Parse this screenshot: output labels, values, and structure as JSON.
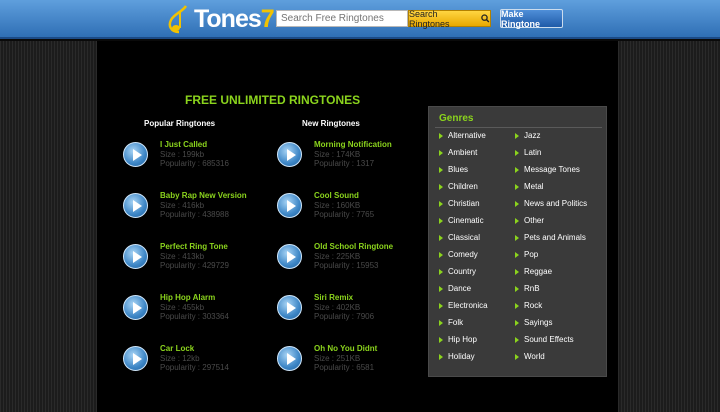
{
  "header": {
    "logo_text": "Tones",
    "logo_seven": "7",
    "search_placeholder": "Search Free Ringtones",
    "search_button": "Search Ringtones",
    "make_button": "Make Ringtone"
  },
  "main": {
    "title": "FREE UNLIMITED RINGTONES",
    "popular_heading": "Popular Ringtones",
    "new_heading": "New Ringtones",
    "popular": [
      {
        "name": "I Just Called",
        "size": "Size : 199kb",
        "popularity": "Popularity : 685316"
      },
      {
        "name": "Baby Rap New Version",
        "size": "Size : 416kb",
        "popularity": "Popularity : 438988"
      },
      {
        "name": "Perfect Ring Tone",
        "size": "Size : 413kb",
        "popularity": "Popularity : 429729"
      },
      {
        "name": "Hip Hop Alarm",
        "size": "Size : 455kb",
        "popularity": "Popularity : 303364"
      },
      {
        "name": "Car Lock",
        "size": "Size : 12kb",
        "popularity": "Popularity : 297514"
      }
    ],
    "new": [
      {
        "name": "Morning Notification",
        "size": "Size : 174KB",
        "popularity": "Popularity : 1317"
      },
      {
        "name": "Cool Sound",
        "size": "Size : 160KB",
        "popularity": "Popularity : 7765"
      },
      {
        "name": "Old School Ringtone",
        "size": "Size : 225KB",
        "popularity": "Popularity : 15953"
      },
      {
        "name": "Siri Remix",
        "size": "Size : 402KB",
        "popularity": "Popularity : 7906"
      },
      {
        "name": "Oh No You Didnt",
        "size": "Size : 251KB",
        "popularity": "Popularity : 6581"
      }
    ]
  },
  "genres": {
    "title": "Genres",
    "left": [
      "Alternative",
      "Ambient",
      "Blues",
      "Children",
      "Christian",
      "Cinematic",
      "Classical",
      "Comedy",
      "Country",
      "Dance",
      "Electronica",
      "Folk",
      "Hip Hop",
      "Holiday"
    ],
    "right": [
      "Jazz",
      "Latin",
      "Message Tones",
      "Metal",
      "News and Politics",
      "Other",
      "Pets and Animals",
      "Pop",
      "Reggae",
      "RnB",
      "Rock",
      "Sayings",
      "Sound Effects",
      "World"
    ]
  },
  "colors": {
    "accent": "#8bd41d",
    "header": "#3f7fc6",
    "search_button": "#f2c200"
  },
  "icons": {
    "logo": "music-note-icon",
    "search": "magnifier-icon",
    "play": "play-icon",
    "bullet": "triangle-bullet-icon"
  }
}
